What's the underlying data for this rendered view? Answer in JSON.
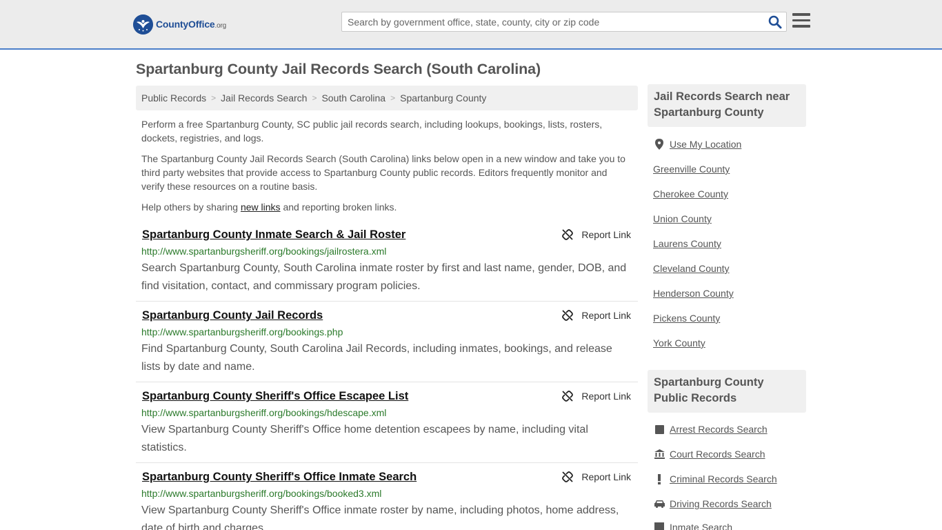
{
  "header": {
    "logo_brand": "County",
    "logo_office": "Office",
    "logo_tld": ".org",
    "search_placeholder": "Search by government office, state, county, city or zip code",
    "accent_color": "#4a7ec8",
    "search_icon": "search-icon",
    "menu_icon": "hamburger-menu-icon"
  },
  "page": {
    "title": "Spartanburg County Jail Records Search (South Carolina)"
  },
  "breadcrumb": [
    "Public Records",
    "Jail Records Search",
    "South Carolina",
    "Spartanburg County"
  ],
  "intro": {
    "p1": "Perform a free Spartanburg County, SC public jail records search, including lookups, bookings, lists, rosters, dockets, registries, and logs.",
    "p2": "The Spartanburg County Jail Records Search (South Carolina) links below open in a new window and take you to third party websites that provide access to Spartanburg County public records. Editors frequently monitor and verify these resources on a routine basis.",
    "p3_before": "Help others by sharing ",
    "p3_link": "new links",
    "p3_after": " and reporting broken links."
  },
  "report_label": "Report Link",
  "results": [
    {
      "title": "Spartanburg County Inmate Search & Jail Roster",
      "url": "http://www.spartanburgsheriff.org/bookings/jailrostera.xml",
      "desc": "Search Spartanburg County, South Carolina inmate roster by first and last name, gender, DOB, and find visitation, contact, and commissary program policies."
    },
    {
      "title": "Spartanburg County Jail Records",
      "url": "http://www.spartanburgsheriff.org/bookings.php",
      "desc": "Find Spartanburg County, South Carolina Jail Records, including inmates, bookings, and release lists by date and name."
    },
    {
      "title": "Spartanburg County Sheriff's Office Escapee List",
      "url": "http://www.spartanburgsheriff.org/bookings/hdescape.xml",
      "desc": "View Spartanburg County Sheriff's Office home detention escapees by name, including vital statistics."
    },
    {
      "title": "Spartanburg County Sheriff's Office Inmate Search",
      "url": "http://www.spartanburgsheriff.org/bookings/booked3.xml",
      "desc": "View Spartanburg County Sheriff's Office inmate roster by name, including photos, home address, date of birth and charges."
    }
  ],
  "sidebar": {
    "nearby_heading": "Jail Records Search near Spartanburg County",
    "use_location": "Use My Location",
    "nearby": [
      "Greenville County",
      "Cherokee County",
      "Union County",
      "Laurens County",
      "Cleveland County",
      "Henderson County",
      "Pickens County",
      "York County"
    ],
    "public_heading": "Spartanburg County Public Records",
    "public": [
      {
        "label": "Arrest Records Search",
        "icon": "square-icon"
      },
      {
        "label": "Court Records Search",
        "icon": "courthouse-icon"
      },
      {
        "label": "Criminal Records Search",
        "icon": "exclamation-icon"
      },
      {
        "label": "Driving Records Search",
        "icon": "car-icon"
      },
      {
        "label": "Inmate Search",
        "icon": "inmate-icon"
      }
    ]
  }
}
